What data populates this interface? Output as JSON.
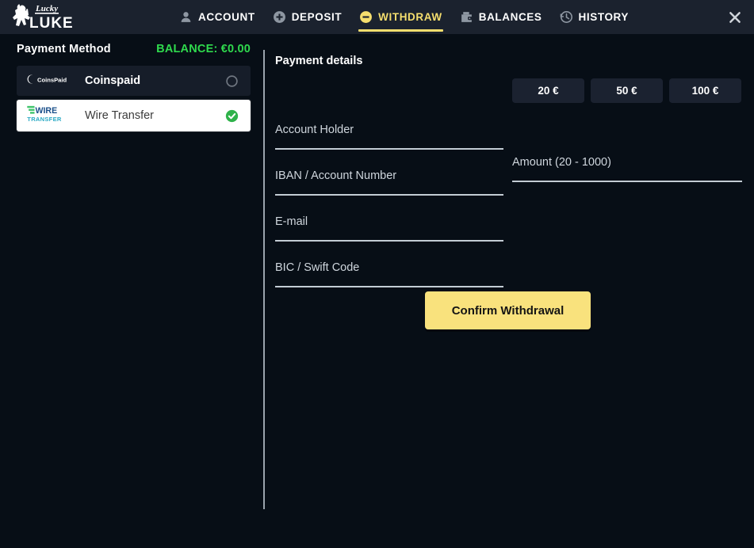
{
  "brand": {
    "logo_top_text": "Lucky",
    "logo_bottom_text": "LUKE"
  },
  "header": {
    "tabs": [
      {
        "label": "ACCOUNT",
        "icon": "user-icon",
        "active": false
      },
      {
        "label": "DEPOSIT",
        "icon": "plus-circle-icon",
        "active": false
      },
      {
        "label": "WITHDRAW",
        "icon": "minus-circle-icon",
        "active": true
      },
      {
        "label": "BALANCES",
        "icon": "wallet-icon",
        "active": false
      },
      {
        "label": "HISTORY",
        "icon": "clock-history-icon",
        "active": false
      }
    ],
    "close_icon": "close-icon",
    "active_color": "#f5de6e"
  },
  "sidebar": {
    "title": "Payment Method",
    "balance_label": "BALANCE: €0.00",
    "balance_color": "#2fd94d",
    "methods": [
      {
        "label": "Coinspaid",
        "logo": "coinspaid-logo",
        "selected": false,
        "state_icon": "radio-empty-icon"
      },
      {
        "label": "Wire Transfer",
        "logo": "wire-transfer-logo",
        "selected": true,
        "state_icon": "check-circle-icon"
      }
    ]
  },
  "main": {
    "details_title": "Payment details",
    "fields": [
      {
        "label": "Account Holder",
        "value": "",
        "placeholder": ""
      },
      {
        "label": "IBAN / Account Number",
        "value": "",
        "placeholder": ""
      },
      {
        "label": "E-mail",
        "value": "",
        "placeholder": ""
      },
      {
        "label": "BIC / Swift Code",
        "value": "",
        "placeholder": ""
      }
    ],
    "amount_field": {
      "label": "Amount (20 - 1000)",
      "value": "",
      "placeholder": ""
    },
    "quick_amounts": [
      "20 €",
      "50 €",
      "100 €"
    ],
    "confirm_label": "Confirm Withdrawal",
    "confirm_color": "#f9e27d"
  }
}
